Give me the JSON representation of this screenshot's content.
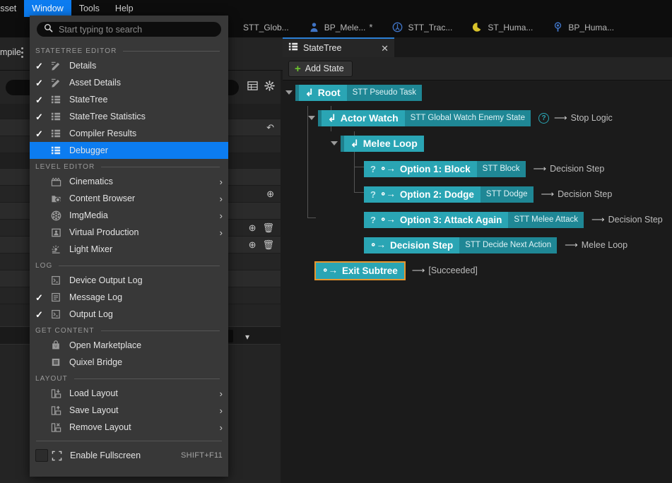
{
  "menubar": {
    "items": [
      {
        "label": "Asset",
        "active": false
      },
      {
        "label": "Window",
        "active": true
      },
      {
        "label": "Tools",
        "active": false
      },
      {
        "label": "Help",
        "active": false
      }
    ]
  },
  "asset_tabs": [
    {
      "label": "STT_Glob...",
      "icon": "none-icon",
      "dirty": ""
    },
    {
      "label": "BP_Mele...",
      "icon": "character-blueprint-icon",
      "dirty": "*"
    },
    {
      "label": "STT_Trac...",
      "icon": "statetree-task-icon",
      "dirty": ""
    },
    {
      "label": "ST_Huma...",
      "icon": "statetree-asset-icon",
      "dirty": ""
    },
    {
      "label": "BP_Huma...",
      "icon": "blueprint-actor-icon",
      "dirty": ""
    }
  ],
  "left_panel": {
    "compile_label": "mpile",
    "search_placeholder": ""
  },
  "statetree_panel": {
    "tab_label": "StateTree",
    "tab_icon": "statetree-icon",
    "close_icon": "close-icon",
    "add_state_label": "Add State",
    "add_state_icon": "plus-icon"
  },
  "tree": {
    "nodes": [
      {
        "id": "root",
        "name": "Root",
        "task": "STT Pseudo Task",
        "transition": "",
        "transition_icon": "",
        "has_question": false,
        "has_caret": true,
        "selected": false,
        "depth": 0
      },
      {
        "id": "actor-watch",
        "name": "Actor Watch",
        "task": "STT Global Watch Enemy State",
        "transition": "Stop Logic",
        "transition_icon": "arrow-right-icon",
        "has_question": false,
        "has_condition_circle": true,
        "has_caret": true,
        "selected": false,
        "depth": 1
      },
      {
        "id": "melee-loop",
        "name": "Melee Loop",
        "task": "",
        "transition": "",
        "transition_icon": "",
        "has_question": false,
        "has_caret": true,
        "selected": false,
        "depth": 2
      },
      {
        "id": "option-1-block",
        "name": "Option 1: Block",
        "task": "STT Block",
        "transition": "Decision Step",
        "transition_icon": "arrow-right-icon",
        "has_question": true,
        "has_caret": false,
        "selected": false,
        "depth": 3
      },
      {
        "id": "option-2-dodge",
        "name": "Option 2: Dodge",
        "task": "STT Dodge",
        "transition": "Decision Step",
        "transition_icon": "arrow-right-icon",
        "has_question": true,
        "has_caret": false,
        "selected": false,
        "depth": 3
      },
      {
        "id": "option-3-attack-again",
        "name": "Option 3: Attack Again",
        "task": "STT Melee Attack",
        "transition": "Decision Step",
        "transition_icon": "arrow-right-icon",
        "has_question": true,
        "has_caret": false,
        "selected": false,
        "depth": 3
      },
      {
        "id": "decision-step",
        "name": "Decision Step",
        "task": "STT Decide Next Action",
        "transition": "Melee Loop",
        "transition_icon": "arrow-right-icon",
        "has_question": false,
        "has_caret": false,
        "selected": false,
        "depth": 3
      },
      {
        "id": "exit-subtree",
        "name": "Exit Subtree",
        "task": "",
        "transition": "[Succeeded]",
        "transition_icon": "arrow-right-icon",
        "has_question": false,
        "has_caret": false,
        "selected": true,
        "depth": 1
      }
    ]
  },
  "window_menu": {
    "search_placeholder": "Start typing to search",
    "search_icon": "search-icon",
    "sections": [
      {
        "label": "STATETREE EDITOR",
        "items": [
          {
            "label": "Details",
            "icon": "details-pencil-icon",
            "checked": true,
            "submenu": false,
            "highlight": false,
            "shortcut": ""
          },
          {
            "label": "Asset Details",
            "icon": "details-pencil-icon",
            "checked": true,
            "submenu": false,
            "highlight": false,
            "shortcut": ""
          },
          {
            "label": "StateTree",
            "icon": "statetree-icon",
            "checked": true,
            "submenu": false,
            "highlight": false,
            "shortcut": ""
          },
          {
            "label": "StateTree Statistics",
            "icon": "statetree-icon",
            "checked": true,
            "submenu": false,
            "highlight": false,
            "shortcut": ""
          },
          {
            "label": "Compiler Results",
            "icon": "statetree-icon",
            "checked": true,
            "submenu": false,
            "highlight": false,
            "shortcut": ""
          },
          {
            "label": "Debugger",
            "icon": "statetree-icon",
            "checked": false,
            "submenu": false,
            "highlight": true,
            "shortcut": ""
          }
        ]
      },
      {
        "label": "LEVEL EDITOR",
        "items": [
          {
            "label": "Cinematics",
            "icon": "clapperboard-icon",
            "checked": false,
            "submenu": true,
            "highlight": false,
            "shortcut": ""
          },
          {
            "label": "Content Browser",
            "icon": "folder-search-icon",
            "checked": false,
            "submenu": true,
            "highlight": false,
            "shortcut": ""
          },
          {
            "label": "ImgMedia",
            "icon": "film-reel-icon",
            "checked": false,
            "submenu": true,
            "highlight": false,
            "shortcut": ""
          },
          {
            "label": "Virtual Production",
            "icon": "virtual-production-icon",
            "checked": false,
            "submenu": true,
            "highlight": false,
            "shortcut": ""
          },
          {
            "label": "Light Mixer",
            "icon": "light-mixer-icon",
            "checked": false,
            "submenu": false,
            "highlight": false,
            "shortcut": ""
          }
        ]
      },
      {
        "label": "LOG",
        "items": [
          {
            "label": "Device Output Log",
            "icon": "console-log-icon",
            "checked": false,
            "submenu": false,
            "highlight": false,
            "shortcut": ""
          },
          {
            "label": "Message Log",
            "icon": "message-log-icon",
            "checked": true,
            "submenu": false,
            "highlight": false,
            "shortcut": ""
          },
          {
            "label": "Output Log",
            "icon": "console-log-icon",
            "checked": true,
            "submenu": false,
            "highlight": false,
            "shortcut": ""
          }
        ]
      },
      {
        "label": "GET CONTENT",
        "items": [
          {
            "label": "Open Marketplace",
            "icon": "marketplace-bag-icon",
            "checked": false,
            "submenu": false,
            "highlight": false,
            "shortcut": ""
          },
          {
            "label": "Quixel Bridge",
            "icon": "quixel-bridge-icon",
            "checked": false,
            "submenu": false,
            "highlight": false,
            "shortcut": ""
          }
        ]
      },
      {
        "label": "LAYOUT",
        "items": [
          {
            "label": "Load Layout",
            "icon": "load-layout-icon",
            "checked": false,
            "submenu": true,
            "highlight": false,
            "shortcut": ""
          },
          {
            "label": "Save Layout",
            "icon": "save-layout-icon",
            "checked": false,
            "submenu": true,
            "highlight": false,
            "shortcut": ""
          },
          {
            "label": "Remove Layout",
            "icon": "remove-layout-icon",
            "checked": false,
            "submenu": true,
            "highlight": false,
            "shortcut": ""
          }
        ]
      }
    ],
    "fullscreen": {
      "label": "Enable Fullscreen",
      "shortcut": "SHIFT+F11",
      "icon": "fullscreen-icon",
      "checked": false
    }
  },
  "colors": {
    "accent_blue": "#0c7cf0",
    "state_teal": "#2aa5b4",
    "task_teal": "#1f8795",
    "selection_orange": "#e8962d",
    "plus_green": "#6ec72e",
    "menu_bg": "#383838"
  }
}
